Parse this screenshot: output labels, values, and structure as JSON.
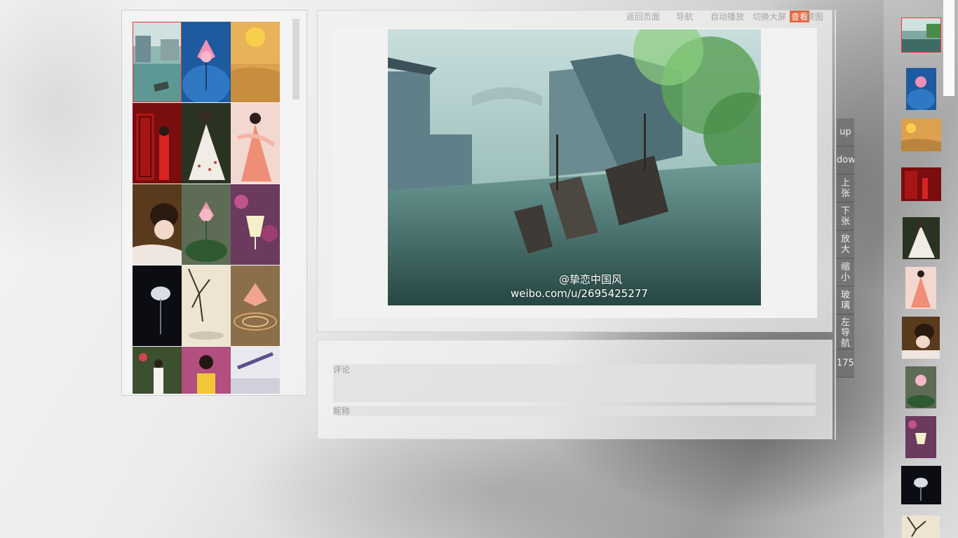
{
  "topnav": {
    "back": "返回页面",
    "nav": "导航",
    "autoplay": "自动播放",
    "fullscreen": "切换大屏",
    "view": "查看",
    "original": "原图"
  },
  "watermark": {
    "handle": "@挚恋中国风",
    "url": "weibo.com/u/2695425277"
  },
  "comment": {
    "comment_label": "评论",
    "nickname_label": "昵称"
  },
  "controls": [
    {
      "label": "up"
    },
    {
      "label": "dow"
    },
    {
      "label": "上张"
    },
    {
      "label": "下张"
    },
    {
      "label": "放大"
    },
    {
      "label": "缩小"
    },
    {
      "label": "玻璃"
    },
    {
      "label": "左导航"
    },
    {
      "label": "175°"
    }
  ],
  "colors": {
    "accent": "#e3673d",
    "selected_border": "#dd3333"
  },
  "gallery": {
    "thumb_icons": [
      "water-town-painting",
      "lotus-blue-umbrella",
      "desert-sunset",
      "red-door-lady",
      "white-dress-lady",
      "pink-dress-lady",
      "sleeping-lady",
      "pink-lotus",
      "wine-glass-flowers",
      "white-lotus-dark",
      "branches-ink",
      "lotus-ripples",
      "garden-girl",
      "yellow-dress-girl",
      "lavender-book"
    ]
  }
}
